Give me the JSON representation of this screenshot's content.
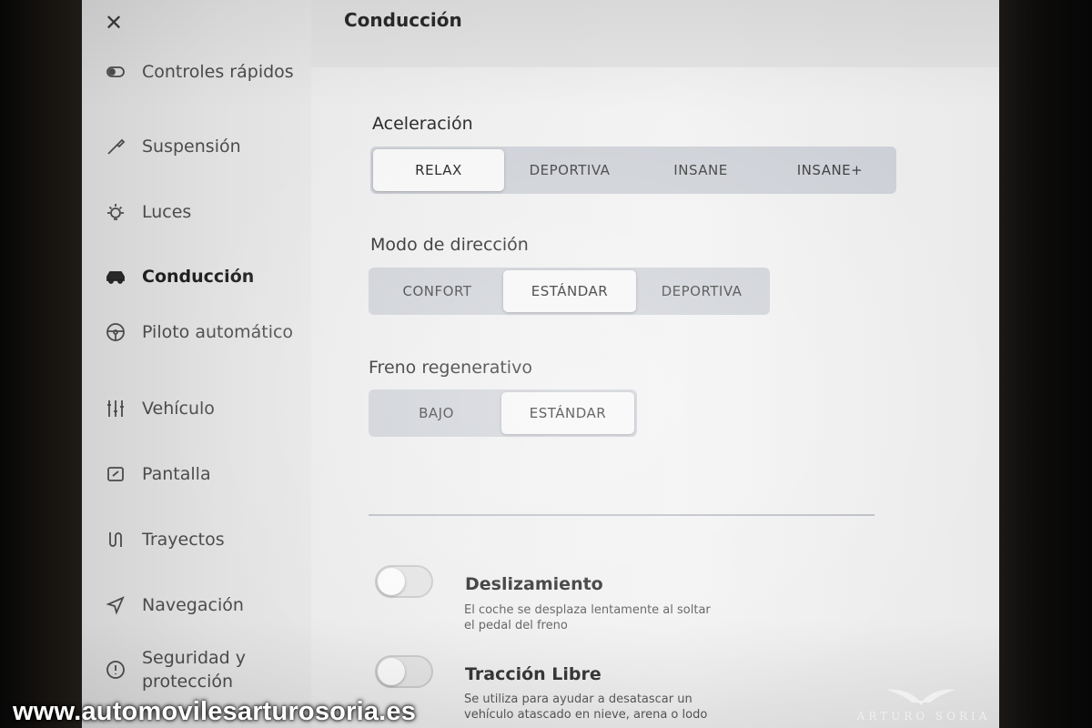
{
  "header": {
    "title": "Conducción"
  },
  "sidebar": {
    "items": [
      {
        "label": "Controles rápidos",
        "icon": "toggle-icon"
      },
      {
        "label": "Suspensión",
        "icon": "wrench-icon"
      },
      {
        "label": "Luces",
        "icon": "light-icon"
      },
      {
        "label": "Conducción",
        "icon": "car-icon",
        "active": true
      },
      {
        "label": "Piloto automático",
        "icon": "steering-wheel-icon"
      },
      {
        "label": "Vehículo",
        "icon": "sliders-icon"
      },
      {
        "label": "Pantalla",
        "icon": "display-icon"
      },
      {
        "label": "Trayectos",
        "icon": "trips-icon"
      },
      {
        "label": "Navegación",
        "icon": "navigation-icon"
      },
      {
        "label": "Seguridad y protección",
        "icon": "info-icon"
      }
    ]
  },
  "acceleration": {
    "label": "Aceleración",
    "options": [
      "RELAX",
      "DEPORTIVA",
      "INSANE",
      "INSANE+"
    ],
    "selected": "RELAX"
  },
  "steering": {
    "label": "Modo de dirección",
    "options": [
      "CONFORT",
      "ESTÁNDAR",
      "DEPORTIVA"
    ],
    "selected": "ESTÁNDAR"
  },
  "regen": {
    "label": "Freno regenerativo",
    "options": [
      "BAJO",
      "ESTÁNDAR"
    ],
    "selected": "ESTÁNDAR"
  },
  "creep": {
    "title": "Deslizamiento",
    "desc_line1": "El coche se desplaza lentamente al soltar",
    "desc_line2": "el pedal del freno",
    "enabled": false
  },
  "slip": {
    "title": "Tracción Libre",
    "desc_line1": "Se utiliza para ayudar a desatascar un",
    "desc_line2": "vehículo atascado en nieve, arena o lodo",
    "enabled": false
  },
  "watermark": {
    "url": "www.automovilesarturosoria.es",
    "brand": "ARTURO SORIA"
  },
  "colors": {
    "segment_bg": "#cdd0d6",
    "segment_selected": "#f6f6f6",
    "screen_bg": "#eeeeee"
  }
}
